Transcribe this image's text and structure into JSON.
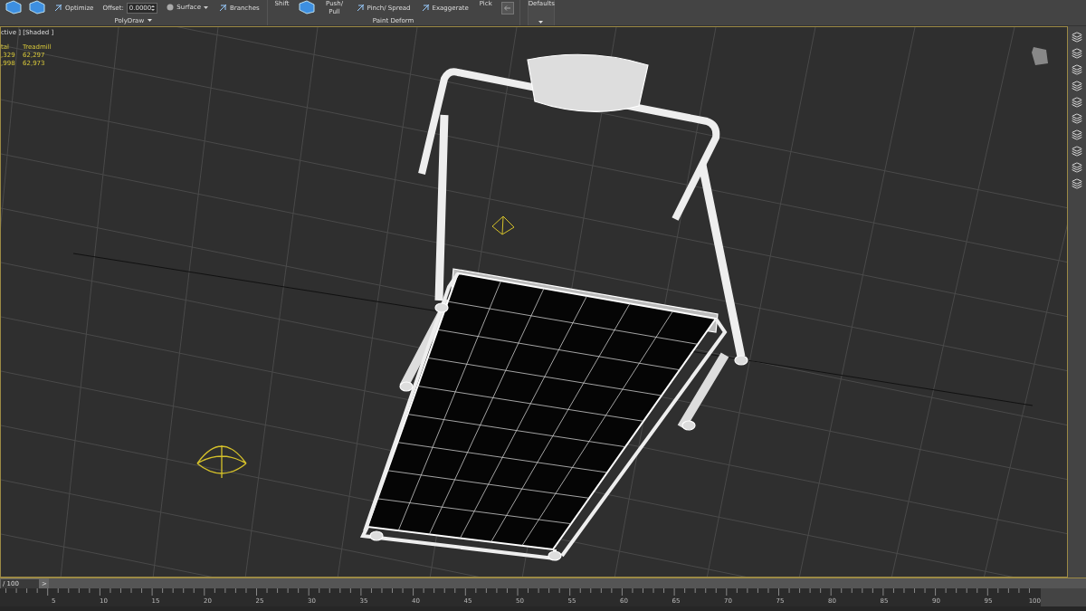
{
  "ribbon": {
    "groups": [
      {
        "label": "PolyDraw",
        "menu": true,
        "tools": [
          {
            "kind": "icon"
          },
          {
            "kind": "icon"
          },
          {
            "kind": "button",
            "label": "Optimize"
          },
          {
            "kind": "spinner",
            "label": "Offset:",
            "value": "0.0000"
          },
          {
            "kind": "dropdown",
            "label": "Surface"
          },
          {
            "kind": "button",
            "label": "Branches"
          }
        ]
      },
      {
        "label": "Paint Deform",
        "menu": false,
        "tools": [
          {
            "kind": "large",
            "label": "Shift"
          },
          {
            "kind": "icon"
          },
          {
            "kind": "large",
            "label": "Push/ Pull"
          },
          {
            "kind": "button",
            "label": "Pinch/ Spread"
          },
          {
            "kind": "button",
            "label": "Exaggerate"
          },
          {
            "kind": "large",
            "label": "Pick"
          },
          {
            "kind": "small-icon"
          }
        ]
      }
    ],
    "defaults": {
      "label": "Defaults"
    }
  },
  "viewport": {
    "label": "ctive ] [Shaded ]",
    "stats": [
      [
        "tal",
        "Treadmill"
      ],
      [
        ",329",
        "62,297"
      ],
      [
        ",998",
        "62,973"
      ]
    ]
  },
  "time_slider": {
    "frame": "/ 100",
    "next": ">"
  },
  "ruler": {
    "labels": [
      "5",
      "10",
      "15",
      "20",
      "25",
      "30",
      "35",
      "40",
      "45",
      "50",
      "55",
      "60",
      "65",
      "70",
      "75",
      "80",
      "85",
      "90",
      "95",
      "100"
    ]
  }
}
